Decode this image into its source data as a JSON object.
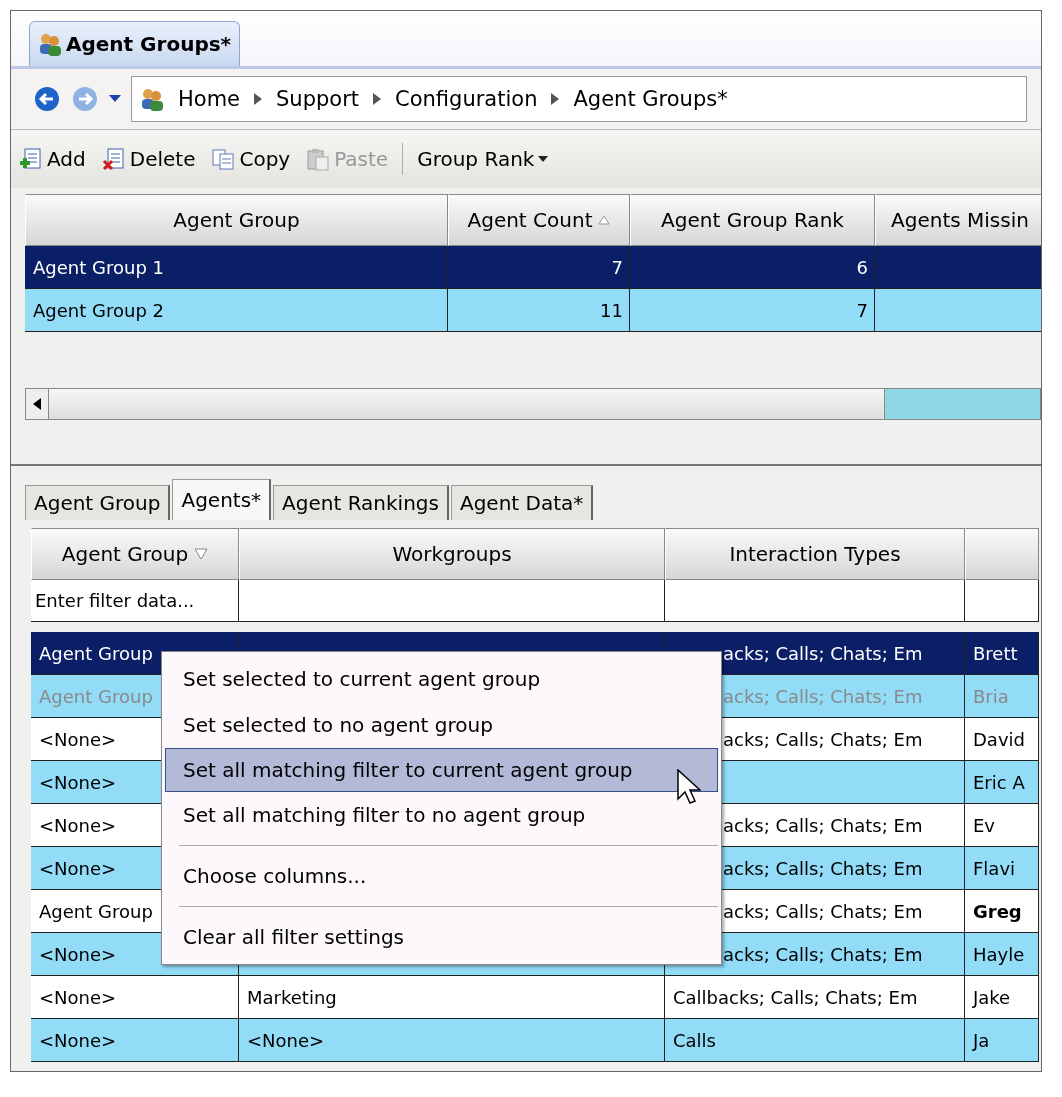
{
  "document_tab": {
    "title": "Agent Groups*"
  },
  "breadcrumb": [
    "Home",
    "Support",
    "Configuration",
    "Agent Groups*"
  ],
  "toolbar": [
    {
      "kind": "add",
      "label": "Add",
      "disabled": false
    },
    {
      "kind": "delete",
      "label": "Delete",
      "disabled": false
    },
    {
      "kind": "copy",
      "label": "Copy",
      "disabled": false
    },
    {
      "kind": "paste",
      "label": "Paste",
      "disabled": true
    },
    {
      "kind": "dropdown",
      "label": "Group Rank",
      "disabled": false
    }
  ],
  "groups_table": {
    "columns": [
      {
        "label": "Agent Group",
        "sorted": false
      },
      {
        "label": "Agent Count",
        "sorted": true
      },
      {
        "label": "Agent Group Rank",
        "sorted": false
      },
      {
        "label": "Agents Missin",
        "sorted": false
      }
    ],
    "rows": [
      {
        "cells": [
          "Agent Group 1",
          "7",
          "6",
          ""
        ],
        "selected": true
      },
      {
        "cells": [
          "Agent Group 2",
          "11",
          "7",
          ""
        ],
        "selected": false
      }
    ]
  },
  "detail_tabs": [
    {
      "label": "Agent Group",
      "selected": false
    },
    {
      "label": "Agents*",
      "selected": true
    },
    {
      "label": "Agent Rankings",
      "selected": false
    },
    {
      "label": "Agent Data*",
      "selected": false
    }
  ],
  "agents_table": {
    "columns": [
      {
        "label": "Agent Group",
        "filtered": true
      },
      {
        "label": "Workgroups",
        "filtered": false
      },
      {
        "label": "Interaction Types",
        "filtered": false
      },
      {
        "filtered": false
      }
    ],
    "filter_placeholder": "Enter filter data...",
    "rows": [
      {
        "agent_group": "Agent Group",
        "workgroups": "",
        "interaction_types": "acks; Calls; Chats; Em",
        "types_covered": true,
        "name": "Brett",
        "name_bold": false,
        "selected": true,
        "dimmed": false
      },
      {
        "agent_group": "Agent Group",
        "workgroups": "",
        "interaction_types": "acks; Calls; Chats; Em",
        "types_covered": true,
        "name": "Bria",
        "name_bold": false,
        "selected": false,
        "dimmed": true
      },
      {
        "agent_group": "<None>",
        "workgroups": "",
        "interaction_types": "acks; Calls; Chats; Em",
        "types_covered": true,
        "name": "David",
        "name_bold": false,
        "selected": false,
        "dimmed": false
      },
      {
        "agent_group": "<None>",
        "workgroups": "",
        "interaction_types": "",
        "name": "Eric A",
        "name_bold": false,
        "selected": false,
        "dimmed": false
      },
      {
        "agent_group": "<None>",
        "workgroups": "",
        "interaction_types": "acks; Calls; Chats; Em",
        "types_covered": true,
        "name": "Ev",
        "name_bold": false,
        "selected": false,
        "dimmed": false
      },
      {
        "agent_group": "<None>",
        "workgroups": "",
        "interaction_types": "acks; Calls; Chats; Em",
        "types_covered": true,
        "name": "Flavi",
        "name_bold": false,
        "selected": false,
        "dimmed": false
      },
      {
        "agent_group": "Agent Group",
        "workgroups": "",
        "interaction_types": "acks; Calls; Chats; Em",
        "types_covered": true,
        "name": "Greg",
        "name_bold": true,
        "selected": false,
        "dimmed": false
      },
      {
        "agent_group": "<None>",
        "workgroups": "",
        "interaction_types": "acks; Calls; Chats; Em",
        "types_covered": true,
        "name": "Hayle",
        "name_bold": false,
        "selected": false,
        "dimmed": false
      },
      {
        "agent_group": "<None>",
        "workgroups": "Marketing",
        "interaction_types": "Callbacks; Calls; Chats; Em",
        "types_covered": false,
        "name": "Jake",
        "name_bold": false,
        "selected": false,
        "dimmed": false
      },
      {
        "agent_group": "<None>",
        "workgroups": "<None>",
        "interaction_types": "Calls",
        "types_covered": false,
        "name": "Ja",
        "name_bold": false,
        "selected": false,
        "dimmed": false
      }
    ]
  },
  "context_menu": [
    {
      "kind": "item",
      "label": "Set selected to current agent group",
      "selected": false
    },
    {
      "kind": "item",
      "label": "Set selected to no agent group",
      "selected": false
    },
    {
      "kind": "item",
      "label": "Set all matching filter to current agent group",
      "selected": true
    },
    {
      "kind": "item",
      "label": "Set all matching filter to no agent group",
      "selected": false
    },
    {
      "kind": "separator"
    },
    {
      "kind": "item",
      "label": "Choose columns...",
      "selected": false
    },
    {
      "kind": "separator"
    },
    {
      "kind": "item",
      "label": "Clear all filter settings",
      "selected": false
    }
  ]
}
